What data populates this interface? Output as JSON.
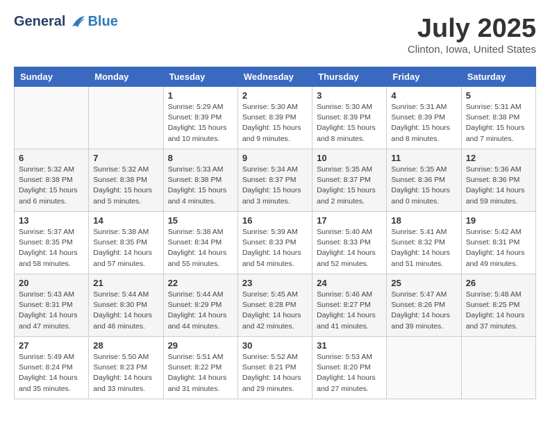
{
  "header": {
    "logo_general": "General",
    "logo_blue": "Blue",
    "month_title": "July 2025",
    "location": "Clinton, Iowa, United States"
  },
  "days_of_week": [
    "Sunday",
    "Monday",
    "Tuesday",
    "Wednesday",
    "Thursday",
    "Friday",
    "Saturday"
  ],
  "weeks": [
    [
      {
        "day": "",
        "info": ""
      },
      {
        "day": "",
        "info": ""
      },
      {
        "day": "1",
        "info": "Sunrise: 5:29 AM\nSunset: 8:39 PM\nDaylight: 15 hours and 10 minutes."
      },
      {
        "day": "2",
        "info": "Sunrise: 5:30 AM\nSunset: 8:39 PM\nDaylight: 15 hours and 9 minutes."
      },
      {
        "day": "3",
        "info": "Sunrise: 5:30 AM\nSunset: 8:39 PM\nDaylight: 15 hours and 8 minutes."
      },
      {
        "day": "4",
        "info": "Sunrise: 5:31 AM\nSunset: 8:39 PM\nDaylight: 15 hours and 8 minutes."
      },
      {
        "day": "5",
        "info": "Sunrise: 5:31 AM\nSunset: 8:38 PM\nDaylight: 15 hours and 7 minutes."
      }
    ],
    [
      {
        "day": "6",
        "info": "Sunrise: 5:32 AM\nSunset: 8:38 PM\nDaylight: 15 hours and 6 minutes."
      },
      {
        "day": "7",
        "info": "Sunrise: 5:32 AM\nSunset: 8:38 PM\nDaylight: 15 hours and 5 minutes."
      },
      {
        "day": "8",
        "info": "Sunrise: 5:33 AM\nSunset: 8:38 PM\nDaylight: 15 hours and 4 minutes."
      },
      {
        "day": "9",
        "info": "Sunrise: 5:34 AM\nSunset: 8:37 PM\nDaylight: 15 hours and 3 minutes."
      },
      {
        "day": "10",
        "info": "Sunrise: 5:35 AM\nSunset: 8:37 PM\nDaylight: 15 hours and 2 minutes."
      },
      {
        "day": "11",
        "info": "Sunrise: 5:35 AM\nSunset: 8:36 PM\nDaylight: 15 hours and 0 minutes."
      },
      {
        "day": "12",
        "info": "Sunrise: 5:36 AM\nSunset: 8:36 PM\nDaylight: 14 hours and 59 minutes."
      }
    ],
    [
      {
        "day": "13",
        "info": "Sunrise: 5:37 AM\nSunset: 8:35 PM\nDaylight: 14 hours and 58 minutes."
      },
      {
        "day": "14",
        "info": "Sunrise: 5:38 AM\nSunset: 8:35 PM\nDaylight: 14 hours and 57 minutes."
      },
      {
        "day": "15",
        "info": "Sunrise: 5:38 AM\nSunset: 8:34 PM\nDaylight: 14 hours and 55 minutes."
      },
      {
        "day": "16",
        "info": "Sunrise: 5:39 AM\nSunset: 8:33 PM\nDaylight: 14 hours and 54 minutes."
      },
      {
        "day": "17",
        "info": "Sunrise: 5:40 AM\nSunset: 8:33 PM\nDaylight: 14 hours and 52 minutes."
      },
      {
        "day": "18",
        "info": "Sunrise: 5:41 AM\nSunset: 8:32 PM\nDaylight: 14 hours and 51 minutes."
      },
      {
        "day": "19",
        "info": "Sunrise: 5:42 AM\nSunset: 8:31 PM\nDaylight: 14 hours and 49 minutes."
      }
    ],
    [
      {
        "day": "20",
        "info": "Sunrise: 5:43 AM\nSunset: 8:31 PM\nDaylight: 14 hours and 47 minutes."
      },
      {
        "day": "21",
        "info": "Sunrise: 5:44 AM\nSunset: 8:30 PM\nDaylight: 14 hours and 46 minutes."
      },
      {
        "day": "22",
        "info": "Sunrise: 5:44 AM\nSunset: 8:29 PM\nDaylight: 14 hours and 44 minutes."
      },
      {
        "day": "23",
        "info": "Sunrise: 5:45 AM\nSunset: 8:28 PM\nDaylight: 14 hours and 42 minutes."
      },
      {
        "day": "24",
        "info": "Sunrise: 5:46 AM\nSunset: 8:27 PM\nDaylight: 14 hours and 41 minutes."
      },
      {
        "day": "25",
        "info": "Sunrise: 5:47 AM\nSunset: 8:26 PM\nDaylight: 14 hours and 39 minutes."
      },
      {
        "day": "26",
        "info": "Sunrise: 5:48 AM\nSunset: 8:25 PM\nDaylight: 14 hours and 37 minutes."
      }
    ],
    [
      {
        "day": "27",
        "info": "Sunrise: 5:49 AM\nSunset: 8:24 PM\nDaylight: 14 hours and 35 minutes."
      },
      {
        "day": "28",
        "info": "Sunrise: 5:50 AM\nSunset: 8:23 PM\nDaylight: 14 hours and 33 minutes."
      },
      {
        "day": "29",
        "info": "Sunrise: 5:51 AM\nSunset: 8:22 PM\nDaylight: 14 hours and 31 minutes."
      },
      {
        "day": "30",
        "info": "Sunrise: 5:52 AM\nSunset: 8:21 PM\nDaylight: 14 hours and 29 minutes."
      },
      {
        "day": "31",
        "info": "Sunrise: 5:53 AM\nSunset: 8:20 PM\nDaylight: 14 hours and 27 minutes."
      },
      {
        "day": "",
        "info": ""
      },
      {
        "day": "",
        "info": ""
      }
    ]
  ]
}
